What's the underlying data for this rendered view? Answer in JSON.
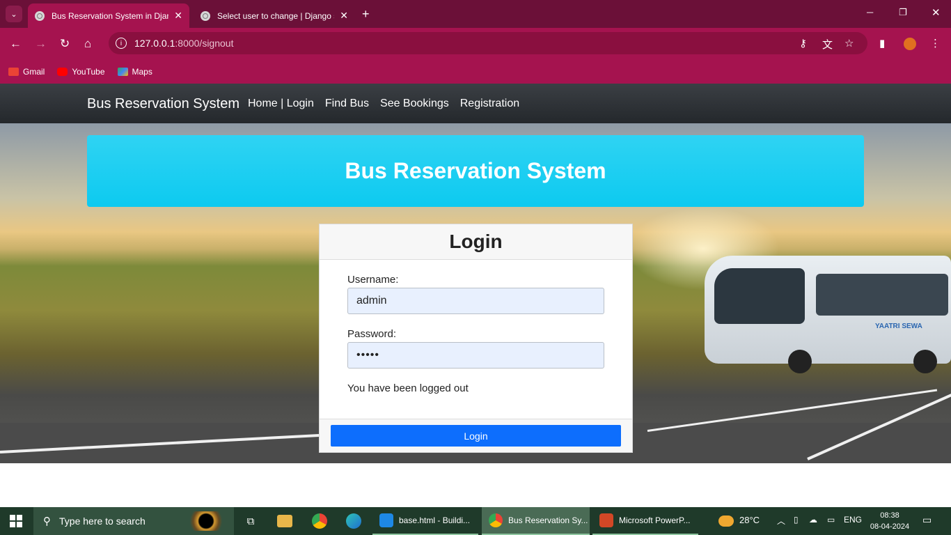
{
  "browser": {
    "tabs": [
      {
        "title": "Bus Reservation System in Djang",
        "active": true
      },
      {
        "title": "Select user to change | Django s",
        "active": false
      }
    ],
    "new_tab": "+",
    "address": {
      "host": "127.0.0.1",
      "path": ":8000/signout"
    },
    "bookmarks": [
      {
        "label": "Gmail",
        "icon": "gmail-icon"
      },
      {
        "label": "YouTube",
        "icon": "youtube-icon"
      },
      {
        "label": "Maps",
        "icon": "maps-icon"
      }
    ],
    "colors": {
      "tabstrip": "#6b1038",
      "toolbar": "#a5134f"
    }
  },
  "site": {
    "brand": "Bus Reservation System",
    "nav": [
      "Home | Login",
      "Find Bus",
      "See Bookings",
      "Registration"
    ],
    "banner_title": "Bus Reservation System",
    "bus_logo": "YAATRI SEWA",
    "colors": {
      "banner": "#0dcaf0",
      "primary": "#0d6efd"
    }
  },
  "login": {
    "title": "Login",
    "username_label": "Username:",
    "username_value": "admin",
    "password_label": "Password:",
    "password_value": "•••••",
    "message": "You have been logged out",
    "button": "Login"
  },
  "taskbar": {
    "search_placeholder": "Type here to search",
    "apps": [
      {
        "label": "base.html - Buildi...",
        "icon": "vscode-icon"
      },
      {
        "label": "Bus Reservation Sy...",
        "icon": "chrome-icon",
        "active": true
      },
      {
        "label": "Microsoft PowerP...",
        "icon": "powerpoint-icon"
      }
    ],
    "weather": "28°C",
    "language": "ENG",
    "time": "08:38",
    "date": "08-04-2024"
  }
}
